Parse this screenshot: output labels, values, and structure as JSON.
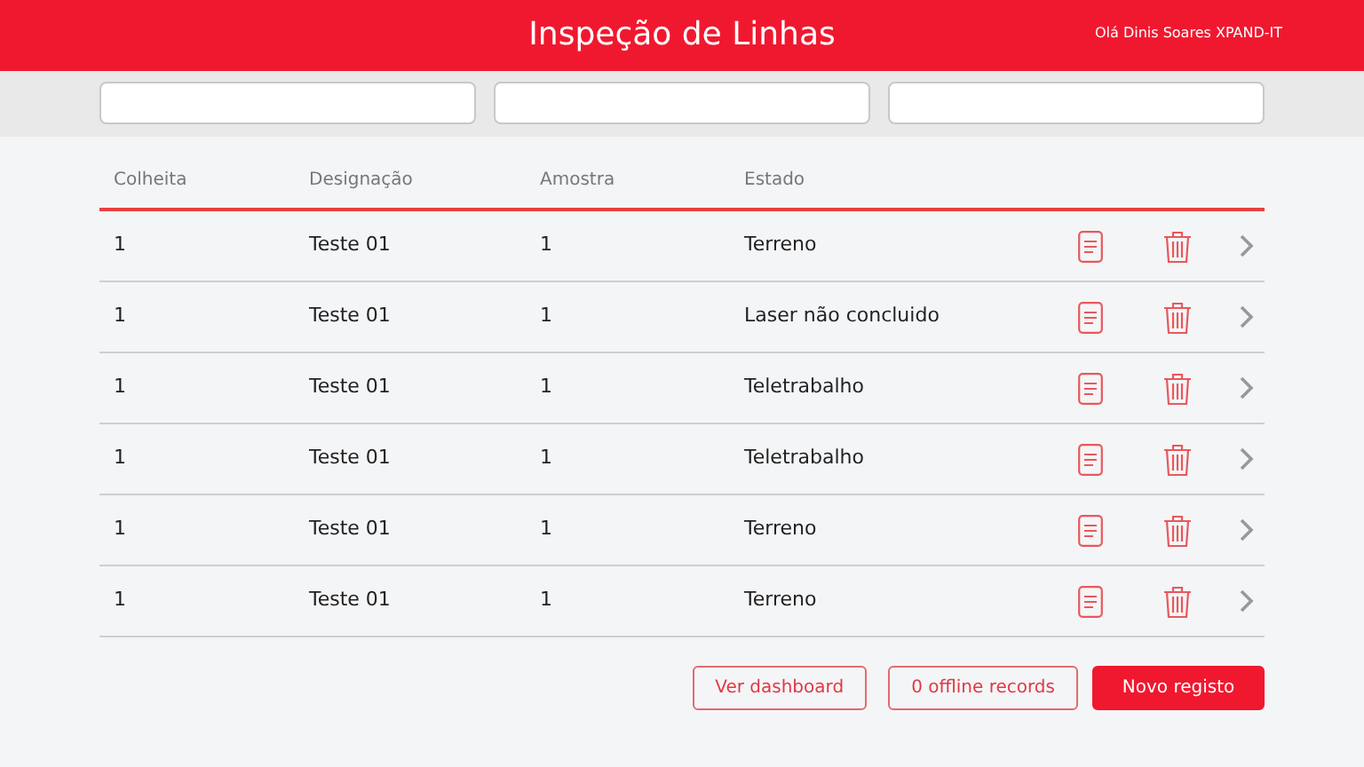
{
  "header": {
    "title": "Inspeção de Linhas",
    "user": "Olá Dinis Soares XPAND-IT"
  },
  "filters": [
    {
      "kind": "text"
    },
    {
      "kind": "text"
    },
    {
      "kind": "text"
    }
  ],
  "table": {
    "columns": [
      "Colheita",
      "Designação",
      "Amostra",
      "Estado"
    ],
    "rows": [
      [
        "1",
        "Teste 01",
        "1",
        "Terreno"
      ],
      [
        "1",
        "Teste 01",
        "1",
        "Laser não concluido"
      ],
      [
        "1",
        "Teste 01",
        "1",
        "Teletrabalho"
      ],
      [
        "1",
        "Teste 01",
        "1",
        "Teletrabalho"
      ],
      [
        "1",
        "Teste 01",
        "1",
        "Terreno"
      ],
      [
        "1",
        "Teste 01",
        "1",
        "Terreno"
      ]
    ]
  },
  "buttons": [
    {
      "label": "Ver dashboard",
      "kind": "outline"
    },
    {
      "label": "0 offline records",
      "kind": "outline"
    },
    {
      "label": "Novo registo",
      "kind": "primary"
    }
  ]
}
